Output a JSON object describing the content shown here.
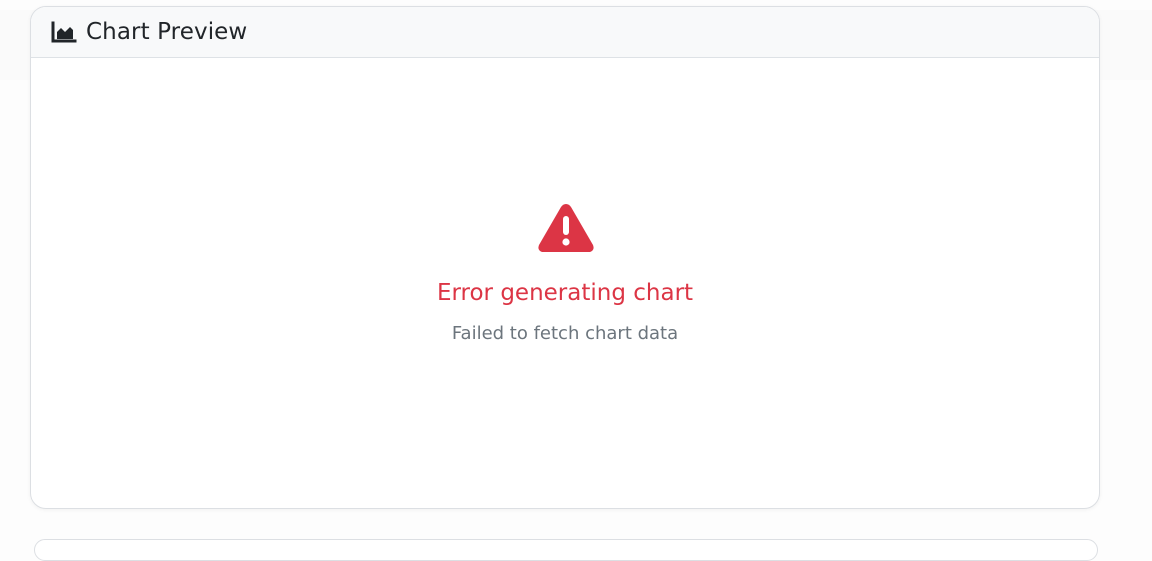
{
  "card": {
    "title": "Chart Preview",
    "header_icon": "chart-area-icon"
  },
  "error": {
    "icon": "warning-triangle-icon",
    "title": "Error generating chart",
    "message": "Failed to fetch chart data"
  },
  "colors": {
    "error": "#dc3545",
    "muted_text": "#6c757d",
    "title_text": "#212529",
    "header_bg": "#f8f9fa"
  }
}
